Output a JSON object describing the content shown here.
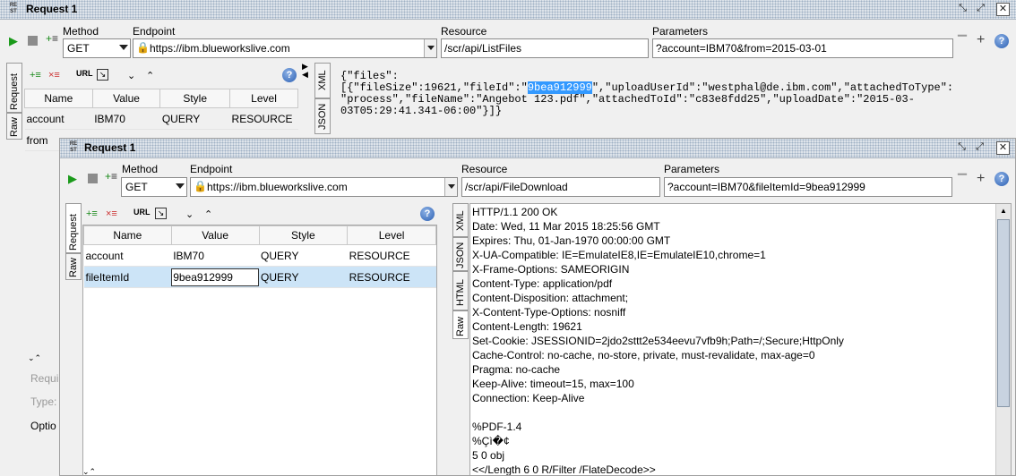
{
  "back_window": {
    "title": "Request 1",
    "method_label": "Method",
    "endpoint_label": "Endpoint",
    "resource_label": "Resource",
    "parameters_label": "Parameters",
    "method": "GET",
    "endpoint": "https://ibm.blueworkslive.com",
    "resource": "/scr/api/ListFiles",
    "parameters": "?account=IBM70&from=2015-03-01",
    "tabs_left": [
      "Request",
      "Raw"
    ],
    "tabs_right": [
      "XML",
      "JSON"
    ],
    "table_headers": [
      "Name",
      "Value",
      "Style",
      "Level"
    ],
    "rows": [
      {
        "name": "account",
        "value": "IBM70",
        "style": "QUERY",
        "level": "RESOURCE"
      },
      {
        "name": "from",
        "value": "",
        "style": "",
        "level": ""
      }
    ],
    "json_pre": "{\"files\":\n[{\"fileSize\":19621,\"fileId\":\"",
    "json_highlight": "9bea912999",
    "json_post": "\",\"uploadUserId\":\"westphal@de.ibm.com\",\"attachedToType\":\n\"process\",\"fileName\":\"Angebot 123.pdf\",\"attachedToId\":\"c83e8fdd25\",\"uploadDate\":\"2015-03-\n03T05:29:41.341-06:00\"}]}",
    "side_labels": [
      "Requi",
      "Type:",
      "Optio"
    ]
  },
  "front_window": {
    "title": "Request 1",
    "method_label": "Method",
    "endpoint_label": "Endpoint",
    "resource_label": "Resource",
    "parameters_label": "Parameters",
    "method": "GET",
    "endpoint": "https://ibm.blueworkslive.com",
    "resource": "/scr/api/FileDownload",
    "parameters": "?account=IBM70&fileItemId=9bea912999",
    "tabs_left": [
      "Request",
      "Raw"
    ],
    "tabs_right": [
      "XML",
      "JSON",
      "HTML",
      "Raw"
    ],
    "table_headers": [
      "Name",
      "Value",
      "Style",
      "Level"
    ],
    "rows": [
      {
        "name": "account",
        "value": "IBM70",
        "style": "QUERY",
        "level": "RESOURCE"
      },
      {
        "name": "fileItemId",
        "value": "9bea912999",
        "style": "QUERY",
        "level": "RESOURCE"
      }
    ],
    "response_lines": [
      "HTTP/1.1 200 OK",
      "Date: Wed, 11 Mar 2015 18:25:56 GMT",
      "Expires: Thu, 01-Jan-1970 00:00:00 GMT",
      "X-UA-Compatible: IE=EmulateIE8,IE=EmulateIE10,chrome=1",
      "X-Frame-Options: SAMEORIGIN",
      "Content-Type: application/pdf",
      "Content-Disposition: attachment;",
      "X-Content-Type-Options: nosniff",
      "Content-Length: 19621",
      "Set-Cookie: JSESSIONID=2jdo2sttt2e534eevu7vfb9h;Path=/;Secure;HttpOnly",
      "Cache-Control: no-cache, no-store, private, must-revalidate, max-age=0",
      "Pragma: no-cache",
      "Keep-Alive: timeout=15, max=100",
      "Connection: Keep-Alive",
      "",
      "%PDF-1.4",
      "%Çì�¢",
      "5 0 obj",
      "<</Length 6 0 R/Filter /FlateDecode>>"
    ]
  },
  "colors": {
    "selection": "#3399ff",
    "selected_row": "#cce4f7",
    "run_green": "#1a9a1a"
  }
}
